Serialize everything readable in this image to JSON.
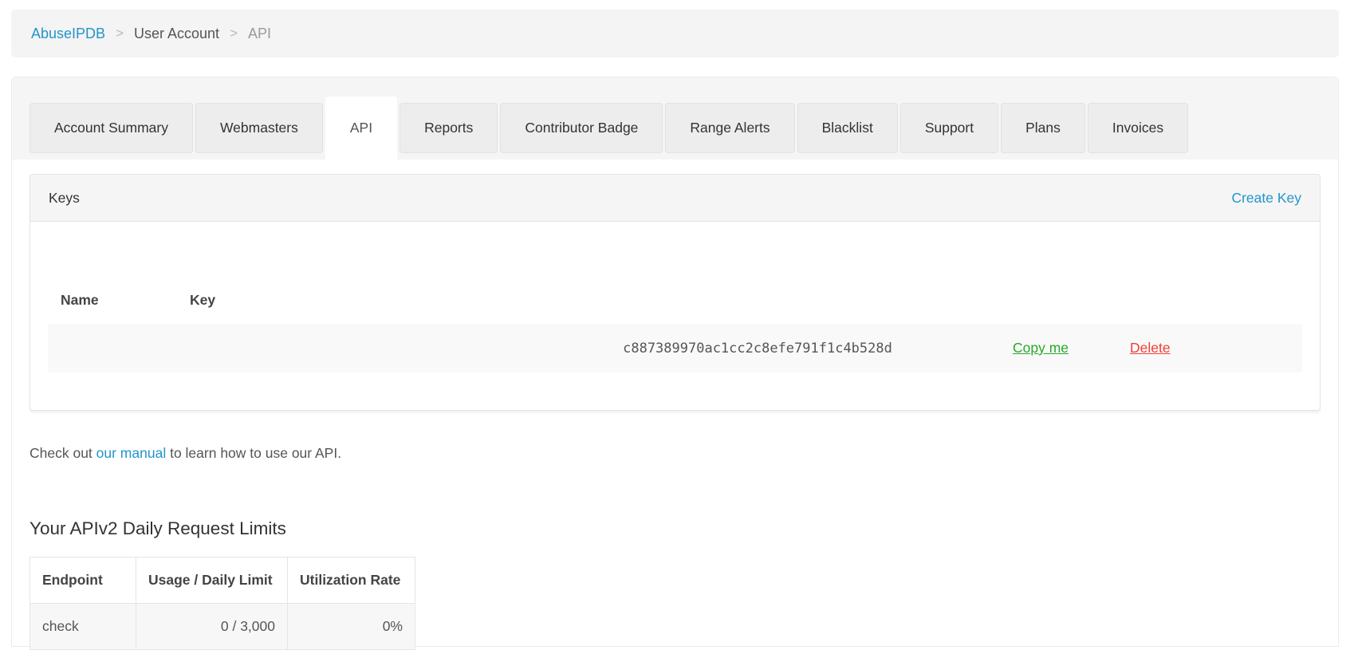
{
  "breadcrumb": {
    "home": "AbuseIPDB",
    "separator": ">",
    "section": "User Account",
    "current": "API"
  },
  "tabs": {
    "items": [
      "Account Summary",
      "Webmasters",
      "API",
      "Reports",
      "Contributor Badge",
      "Range Alerts",
      "Blacklist",
      "Support",
      "Plans",
      "Invoices"
    ],
    "active_tab": "API"
  },
  "keys_panel": {
    "title": "Keys",
    "create_key_label": "Create Key",
    "columns": {
      "name": "Name",
      "key": "Key"
    },
    "rows": [
      {
        "name": "",
        "key": "c887389970ac1cc2c8efe791f1c4b528d",
        "copy_label": "Copy me",
        "delete_label": "Delete"
      }
    ]
  },
  "manual_note": {
    "prefix": "Check out ",
    "link_label": "our manual",
    "suffix": " to learn how to use our API."
  },
  "limits": {
    "heading": "Your APIv2 Daily Request Limits",
    "columns": [
      "Endpoint",
      "Usage / Daily Limit",
      "Utilization Rate"
    ],
    "rows": [
      {
        "endpoint": "check",
        "usage": "0 / 3,000",
        "utilization": "0%"
      }
    ]
  },
  "colors": {
    "link_blue": "#2295cb",
    "copy_green": "#28a82a",
    "delete_red": "#ef4136",
    "panel_header_bg": "#f5f5f5",
    "stripe_row_bg": "#f9f9f9"
  }
}
